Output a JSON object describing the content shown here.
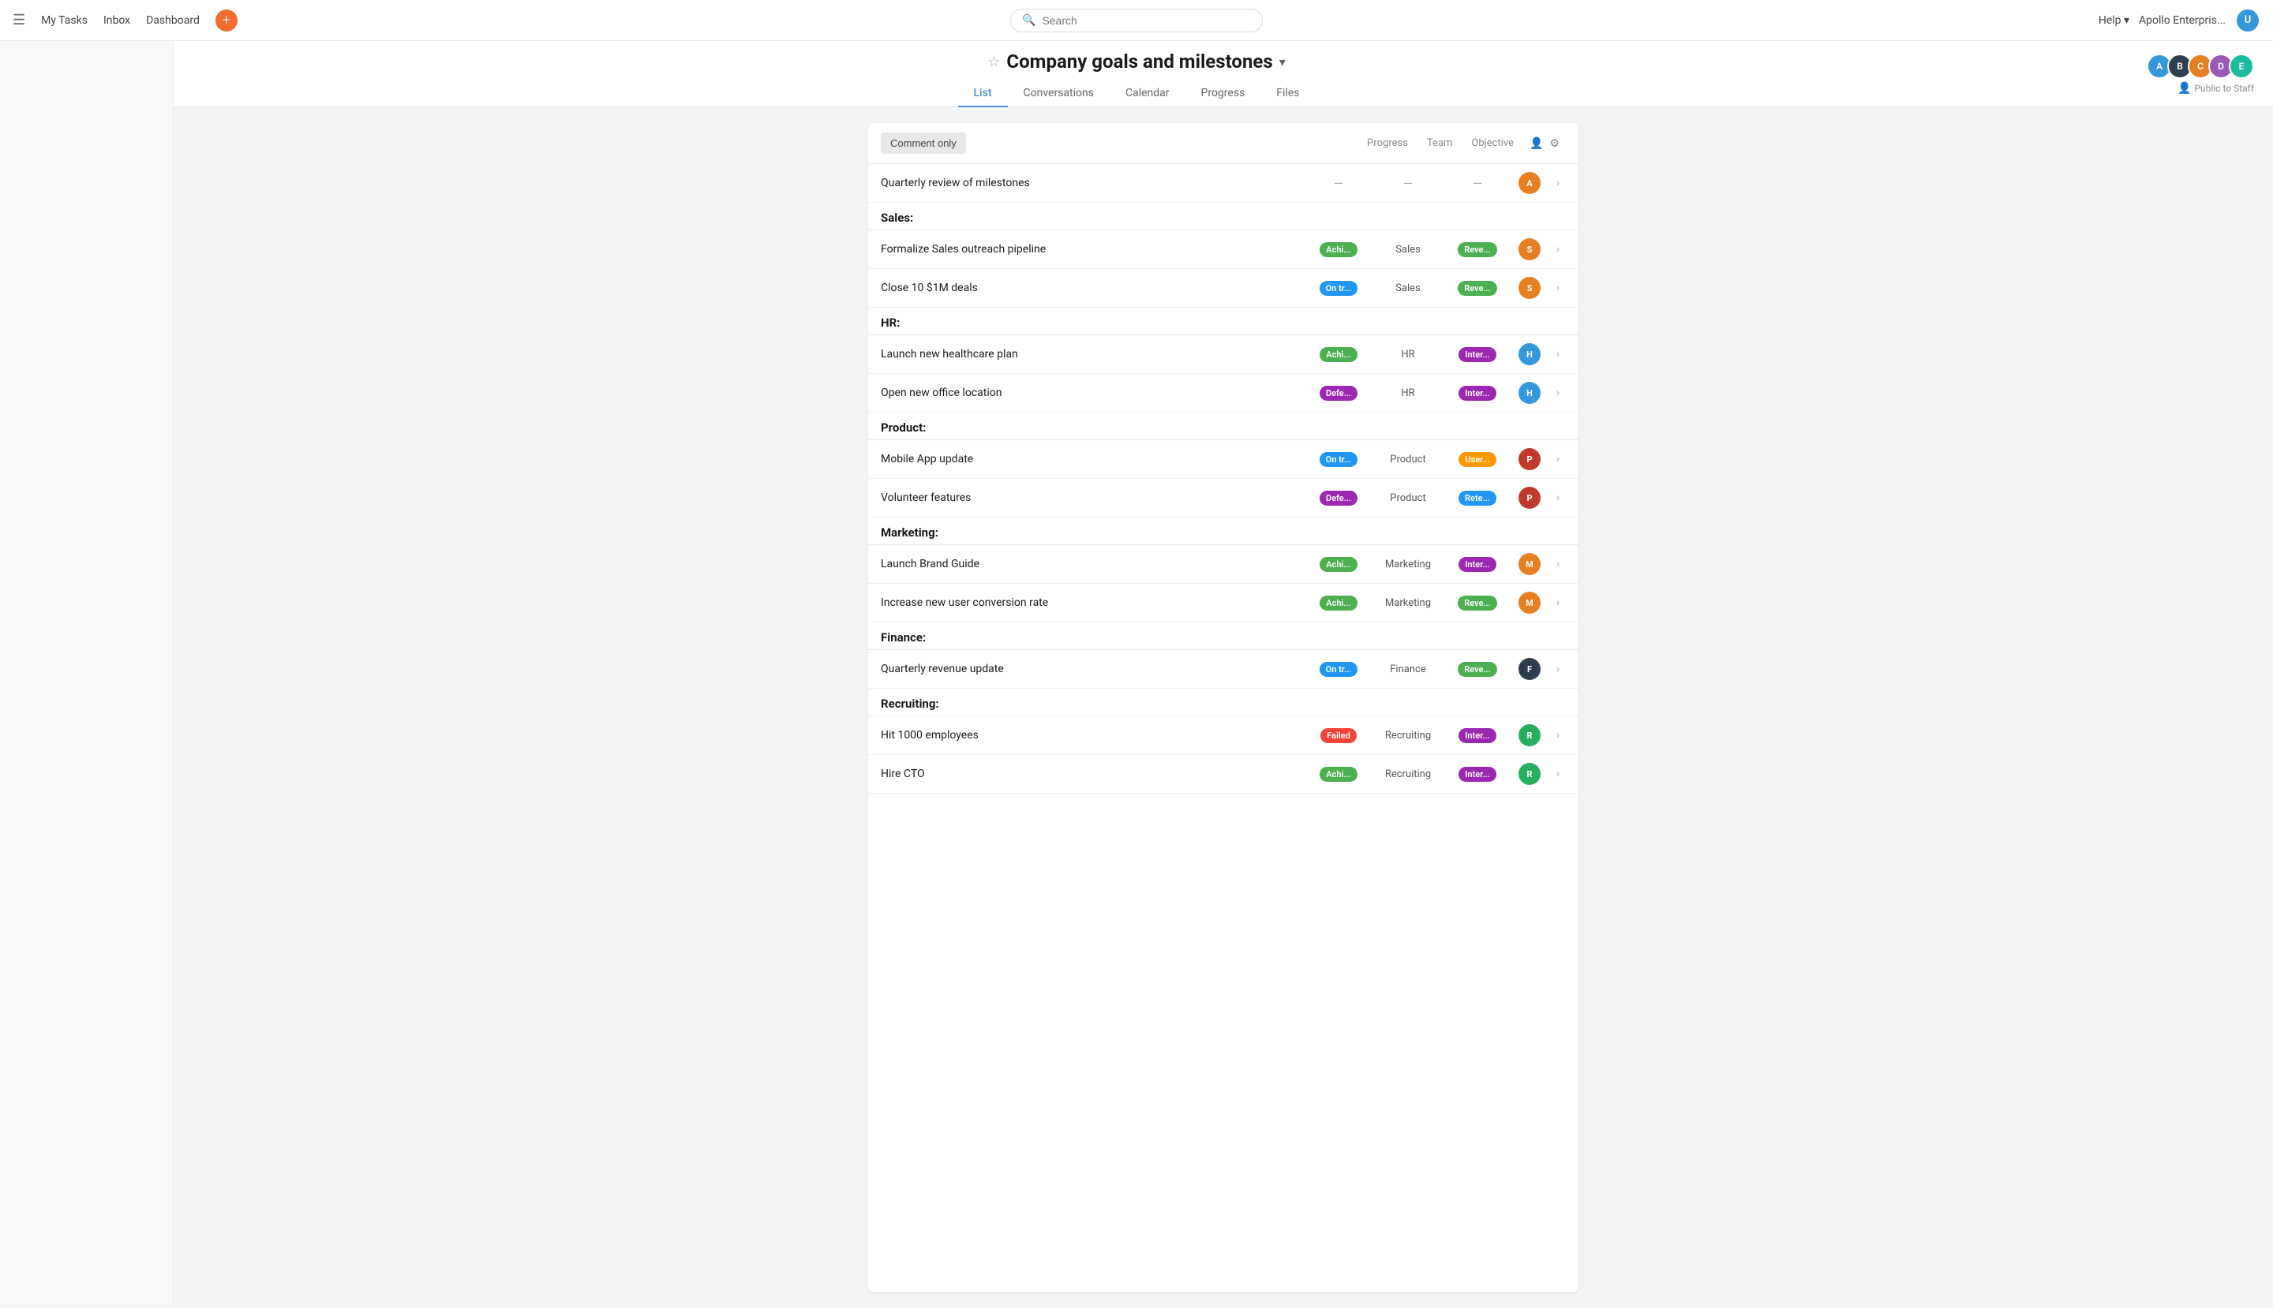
{
  "nav": {
    "hamburger": "☰",
    "my_tasks": "My Tasks",
    "inbox": "Inbox",
    "dashboard": "Dashboard",
    "add_icon": "+",
    "search_placeholder": "Search",
    "help": "Help",
    "company": "Apollo Enterpris...",
    "chevron": "▾"
  },
  "page": {
    "star": "☆",
    "title": "Company goals and milestones",
    "chevron": "▾",
    "tabs": [
      {
        "label": "List",
        "active": true
      },
      {
        "label": "Conversations",
        "active": false
      },
      {
        "label": "Calendar",
        "active": false
      },
      {
        "label": "Progress",
        "active": false
      },
      {
        "label": "Files",
        "active": false
      }
    ],
    "public_badge": "Public to Staff"
  },
  "table": {
    "comment_only": "Comment only",
    "headers": {
      "progress": "Progress",
      "team": "Team",
      "objective": "Objective"
    }
  },
  "sections": [
    {
      "id": "top",
      "title": "",
      "tasks": [
        {
          "name": "Quarterly review of milestones",
          "progress": null,
          "team": null,
          "objective": null,
          "avatar_color": "#e67e22",
          "avatar_letter": "A"
        }
      ]
    },
    {
      "id": "sales",
      "title": "Sales:",
      "tasks": [
        {
          "name": "Formalize Sales outreach pipeline",
          "progress": "Achi...",
          "progress_class": "status-achieved",
          "team": "Sales",
          "objective": "Reve...",
          "obj_class": "obj-revenue",
          "avatar_color": "#e67e22",
          "avatar_letter": "S"
        },
        {
          "name": "Close 10 $1M deals",
          "progress": "On tr...",
          "progress_class": "status-on-track",
          "team": "Sales",
          "objective": "Reve...",
          "obj_class": "obj-revenue",
          "avatar_color": "#e67e22",
          "avatar_letter": "S"
        }
      ]
    },
    {
      "id": "hr",
      "title": "HR:",
      "tasks": [
        {
          "name": "Launch new healthcare plan",
          "progress": "Achi...",
          "progress_class": "status-achieved",
          "team": "HR",
          "objective": "Inter...",
          "obj_class": "obj-internal",
          "avatar_color": "#3498db",
          "avatar_letter": "H"
        },
        {
          "name": "Open new office location",
          "progress": "Defe...",
          "progress_class": "status-deferred",
          "team": "HR",
          "objective": "Inter...",
          "obj_class": "obj-internal",
          "avatar_color": "#3498db",
          "avatar_letter": "H"
        }
      ]
    },
    {
      "id": "product",
      "title": "Product:",
      "tasks": [
        {
          "name": "Mobile App update",
          "progress": "On tr...",
          "progress_class": "status-on-track",
          "team": "Product",
          "objective": "User...",
          "obj_class": "obj-user",
          "avatar_color": "#c0392b",
          "avatar_letter": "P"
        },
        {
          "name": "Volunteer features",
          "progress": "Defe...",
          "progress_class": "status-deferred",
          "team": "Product",
          "objective": "Rete...",
          "obj_class": "obj-retention",
          "avatar_color": "#c0392b",
          "avatar_letter": "P"
        }
      ]
    },
    {
      "id": "marketing",
      "title": "Marketing:",
      "tasks": [
        {
          "name": "Launch Brand Guide",
          "progress": "Achi...",
          "progress_class": "status-achieved",
          "team": "Marketing",
          "objective": "Inter...",
          "obj_class": "obj-internal",
          "avatar_color": "#e67e22",
          "avatar_letter": "M"
        },
        {
          "name": "Increase new user conversion rate",
          "progress": "Achi...",
          "progress_class": "status-achieved",
          "team": "Marketing",
          "objective": "Reve...",
          "obj_class": "obj-revenue",
          "avatar_color": "#e67e22",
          "avatar_letter": "M"
        }
      ]
    },
    {
      "id": "finance",
      "title": "Finance:",
      "tasks": [
        {
          "name": "Quarterly revenue update",
          "progress": "On tr...",
          "progress_class": "status-on-track",
          "team": "Finance",
          "objective": "Reve...",
          "obj_class": "obj-revenue",
          "avatar_color": "#2c3e50",
          "avatar_letter": "F"
        }
      ]
    },
    {
      "id": "recruiting",
      "title": "Recruiting:",
      "tasks": [
        {
          "name": "Hit 1000 employees",
          "progress": "Failed",
          "progress_class": "status-failed",
          "team": "Recruiting",
          "objective": "Inter...",
          "obj_class": "obj-internal",
          "avatar_color": "#27ae60",
          "avatar_letter": "R"
        },
        {
          "name": "Hire CTO",
          "progress": "Achi...",
          "progress_class": "status-achieved",
          "team": "Recruiting",
          "objective": "Inter...",
          "obj_class": "obj-internal",
          "avatar_color": "#27ae60",
          "avatar_letter": "R"
        }
      ]
    }
  ],
  "collaborators": [
    {
      "color": "#3498db",
      "letter": "A"
    },
    {
      "color": "#2c3e50",
      "letter": "B"
    },
    {
      "color": "#e67e22",
      "letter": "C"
    },
    {
      "color": "#9b59b6",
      "letter": "D"
    },
    {
      "color": "#1abc9c",
      "letter": "E"
    }
  ],
  "user_avatar": {
    "color": "#3498db",
    "letter": "U"
  }
}
